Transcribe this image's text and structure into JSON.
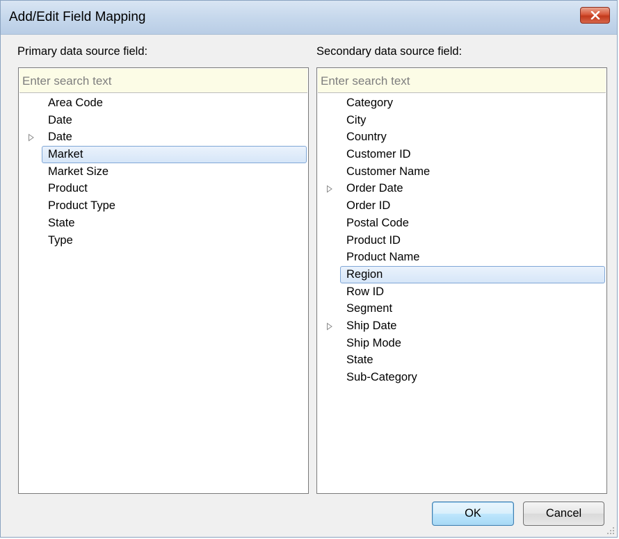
{
  "window": {
    "title": "Add/Edit Field Mapping"
  },
  "primary": {
    "label": "Primary data source field:",
    "search_placeholder": "Enter search text",
    "items": [
      {
        "label": "Area Code"
      },
      {
        "label": "Date"
      },
      {
        "label": "Date",
        "expandable": true
      },
      {
        "label": "Market",
        "selected": true
      },
      {
        "label": "Market Size"
      },
      {
        "label": "Product"
      },
      {
        "label": "Product Type"
      },
      {
        "label": "State"
      },
      {
        "label": "Type"
      }
    ]
  },
  "secondary": {
    "label": "Secondary data source field:",
    "search_placeholder": "Enter search text",
    "items": [
      {
        "label": "Category"
      },
      {
        "label": "City"
      },
      {
        "label": "Country"
      },
      {
        "label": "Customer ID"
      },
      {
        "label": "Customer Name"
      },
      {
        "label": "Order Date",
        "expandable": true
      },
      {
        "label": "Order ID"
      },
      {
        "label": "Postal Code"
      },
      {
        "label": "Product ID"
      },
      {
        "label": "Product Name"
      },
      {
        "label": "Region",
        "selected": true
      },
      {
        "label": "Row ID"
      },
      {
        "label": "Segment"
      },
      {
        "label": "Ship Date",
        "expandable": true
      },
      {
        "label": "Ship Mode"
      },
      {
        "label": "State"
      },
      {
        "label": "Sub-Category"
      }
    ]
  },
  "buttons": {
    "ok": "OK",
    "cancel": "Cancel"
  },
  "icons": {
    "close": "close-icon",
    "expand": "triangle-right-icon",
    "grip": "resize-grip-icon"
  }
}
